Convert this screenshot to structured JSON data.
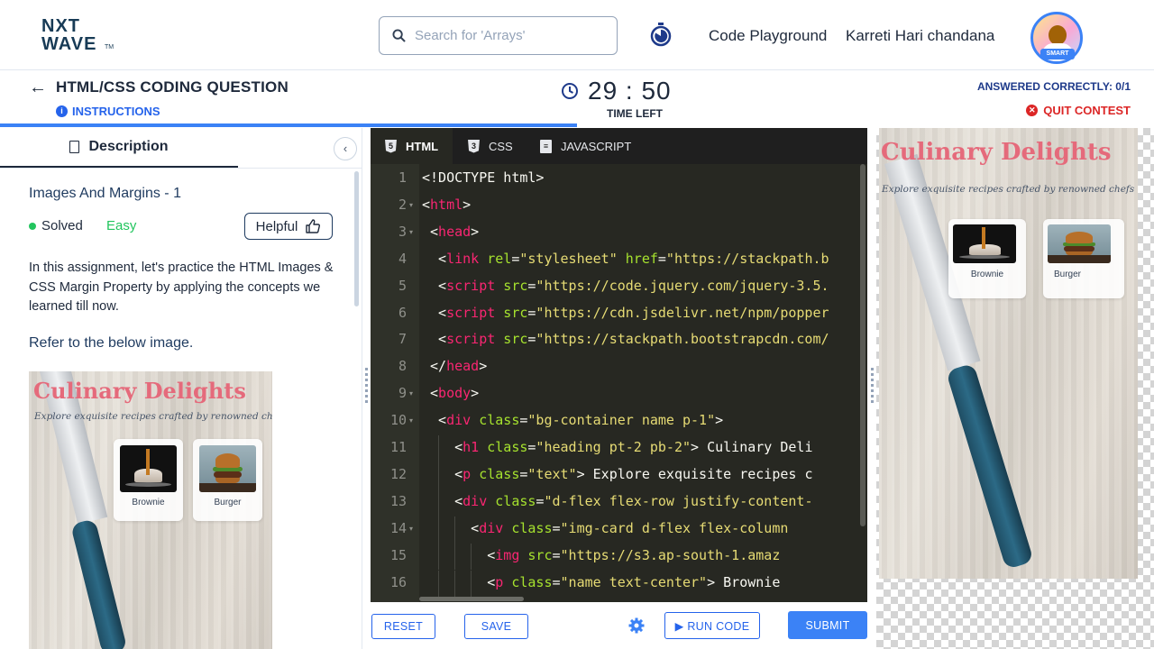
{
  "nav": {
    "logo_line1": "NXT",
    "logo_line2": "WAVE",
    "logo_tm": "TM",
    "search_placeholder": "Search for 'Arrays'",
    "code_playground": "Code Playground",
    "user_name": "Karreti Hari chandana",
    "avatar_badge": "SMART"
  },
  "header": {
    "title": "HTML/CSS CODING QUESTION",
    "instructions": "INSTRUCTIONS",
    "time": "29 : 50",
    "time_left": "TIME LEFT",
    "answered": "ANSWERED CORRECTLY: 0/1",
    "quit": "QUIT CONTEST",
    "progress_fraction": 0.5
  },
  "left_panel": {
    "tab": "Description",
    "problem_title": "Images And Margins - 1",
    "status": "Solved",
    "difficulty": "Easy",
    "helpful": "Helpful",
    "description": "In this assignment, let's practice the HTML Images & CSS Margin Property by applying the concepts we learned till now.",
    "refer": "Refer to the below image."
  },
  "preview": {
    "heading": "Culinary Delights",
    "text": "Explore exquisite recipes crafted by renowned chefs",
    "cards": [
      {
        "name": "Brownie"
      },
      {
        "name": "Burger"
      }
    ]
  },
  "editor": {
    "tabs": [
      "HTML",
      "CSS",
      "JAVASCRIPT"
    ],
    "active_tab": "HTML",
    "line_numbers": [
      "1",
      "2",
      "3",
      "4",
      "5",
      "6",
      "7",
      "8",
      "9",
      "10",
      "11",
      "12",
      "13",
      "14",
      "15",
      "16"
    ],
    "lines": [
      {
        "indent": 0,
        "tokens": [
          {
            "t": "pl",
            "v": "<!DOCTYPE html>"
          }
        ]
      },
      {
        "indent": 0,
        "tokens": [
          {
            "t": "pl",
            "v": "<"
          },
          {
            "t": "tg",
            "v": "html"
          },
          {
            "t": "pl",
            "v": ">"
          }
        ]
      },
      {
        "indent": 1,
        "tokens": [
          {
            "t": "pl",
            "v": "<"
          },
          {
            "t": "tg",
            "v": "head"
          },
          {
            "t": "pl",
            "v": ">"
          }
        ]
      },
      {
        "indent": 2,
        "tokens": [
          {
            "t": "pl",
            "v": "<"
          },
          {
            "t": "tg",
            "v": "link"
          },
          {
            "t": "pl",
            "v": " "
          },
          {
            "t": "at",
            "v": "rel"
          },
          {
            "t": "pl",
            "v": "="
          },
          {
            "t": "st",
            "v": "\"stylesheet\""
          },
          {
            "t": "pl",
            "v": " "
          },
          {
            "t": "at",
            "v": "href"
          },
          {
            "t": "pl",
            "v": "="
          },
          {
            "t": "st",
            "v": "\"https://stackpath.b"
          }
        ]
      },
      {
        "indent": 2,
        "tokens": [
          {
            "t": "pl",
            "v": "<"
          },
          {
            "t": "tg",
            "v": "script"
          },
          {
            "t": "pl",
            "v": " "
          },
          {
            "t": "at",
            "v": "src"
          },
          {
            "t": "pl",
            "v": "="
          },
          {
            "t": "st",
            "v": "\"https://code.jquery.com/jquery-3.5."
          }
        ]
      },
      {
        "indent": 2,
        "tokens": [
          {
            "t": "pl",
            "v": "<"
          },
          {
            "t": "tg",
            "v": "script"
          },
          {
            "t": "pl",
            "v": " "
          },
          {
            "t": "at",
            "v": "src"
          },
          {
            "t": "pl",
            "v": "="
          },
          {
            "t": "st",
            "v": "\"https://cdn.jsdelivr.net/npm/popper"
          }
        ]
      },
      {
        "indent": 2,
        "tokens": [
          {
            "t": "pl",
            "v": "<"
          },
          {
            "t": "tg",
            "v": "script"
          },
          {
            "t": "pl",
            "v": " "
          },
          {
            "t": "at",
            "v": "src"
          },
          {
            "t": "pl",
            "v": "="
          },
          {
            "t": "st",
            "v": "\"https://stackpath.bootstrapcdn.com/"
          }
        ]
      },
      {
        "indent": 1,
        "tokens": [
          {
            "t": "pl",
            "v": "</"
          },
          {
            "t": "tg",
            "v": "head"
          },
          {
            "t": "pl",
            "v": ">"
          }
        ]
      },
      {
        "indent": 1,
        "tokens": [
          {
            "t": "pl",
            "v": "<"
          },
          {
            "t": "tg",
            "v": "body"
          },
          {
            "t": "pl",
            "v": ">"
          }
        ]
      },
      {
        "indent": 2,
        "tokens": [
          {
            "t": "pl",
            "v": "<"
          },
          {
            "t": "tg",
            "v": "div"
          },
          {
            "t": "pl",
            "v": " "
          },
          {
            "t": "at",
            "v": "class"
          },
          {
            "t": "pl",
            "v": "="
          },
          {
            "t": "st",
            "v": "\"bg-container name p-1\""
          },
          {
            "t": "pl",
            "v": ">"
          }
        ]
      },
      {
        "indent": 4,
        "tokens": [
          {
            "t": "pl",
            "v": "<"
          },
          {
            "t": "tg",
            "v": "h1"
          },
          {
            "t": "pl",
            "v": " "
          },
          {
            "t": "at",
            "v": "class"
          },
          {
            "t": "pl",
            "v": "="
          },
          {
            "t": "st",
            "v": "\"heading pt-2 pb-2\""
          },
          {
            "t": "pl",
            "v": "> Culinary Deli"
          }
        ]
      },
      {
        "indent": 4,
        "tokens": [
          {
            "t": "pl",
            "v": "<"
          },
          {
            "t": "tg",
            "v": "p"
          },
          {
            "t": "pl",
            "v": " "
          },
          {
            "t": "at",
            "v": "class"
          },
          {
            "t": "pl",
            "v": "="
          },
          {
            "t": "st",
            "v": "\"text\""
          },
          {
            "t": "pl",
            "v": "> Explore exquisite recipes c"
          }
        ]
      },
      {
        "indent": 4,
        "tokens": [
          {
            "t": "pl",
            "v": "<"
          },
          {
            "t": "tg",
            "v": "div"
          },
          {
            "t": "pl",
            "v": " "
          },
          {
            "t": "at",
            "v": "class"
          },
          {
            "t": "pl",
            "v": "="
          },
          {
            "t": "st",
            "v": "\"d-flex flex-row justify-content-"
          }
        ]
      },
      {
        "indent": 6,
        "tokens": [
          {
            "t": "pl",
            "v": "<"
          },
          {
            "t": "tg",
            "v": "div"
          },
          {
            "t": "pl",
            "v": " "
          },
          {
            "t": "at",
            "v": "class"
          },
          {
            "t": "pl",
            "v": "="
          },
          {
            "t": "st",
            "v": "\"img-card d-flex flex-column "
          }
        ]
      },
      {
        "indent": 8,
        "tokens": [
          {
            "t": "pl",
            "v": "<"
          },
          {
            "t": "tg",
            "v": "img"
          },
          {
            "t": "pl",
            "v": " "
          },
          {
            "t": "at",
            "v": "src"
          },
          {
            "t": "pl",
            "v": "="
          },
          {
            "t": "st",
            "v": "\"https://s3.ap-south-1.amaz"
          }
        ]
      },
      {
        "indent": 8,
        "tokens": [
          {
            "t": "pl",
            "v": "<"
          },
          {
            "t": "tg",
            "v": "p"
          },
          {
            "t": "pl",
            "v": " "
          },
          {
            "t": "at",
            "v": "class"
          },
          {
            "t": "pl",
            "v": "="
          },
          {
            "t": "st",
            "v": "\"name text-center\""
          },
          {
            "t": "pl",
            "v": "> Brownie"
          }
        ]
      }
    ],
    "fold_lines": [
      2,
      3,
      9,
      10,
      14
    ]
  },
  "footer": {
    "reset": "RESET",
    "save": "SAVE",
    "run": "RUN CODE",
    "submit": "SUBMIT"
  },
  "colors": {
    "accent": "#3b82f6",
    "heading_pink": "#e56a7b",
    "success": "#22c55e",
    "danger": "#dc2626",
    "editor_bg": "#272822"
  },
  "icons": {
    "search": "search-icon",
    "timer": "stopwatch-icon",
    "back": "arrow-left-icon",
    "info": "info-icon",
    "clock": "clock-icon",
    "quit": "close-circle-icon",
    "description": "document-icon",
    "collapse": "chevron-left-icon",
    "helpful": "thumbs-up-icon",
    "settings": "gear-icon",
    "run": "play-icon"
  }
}
